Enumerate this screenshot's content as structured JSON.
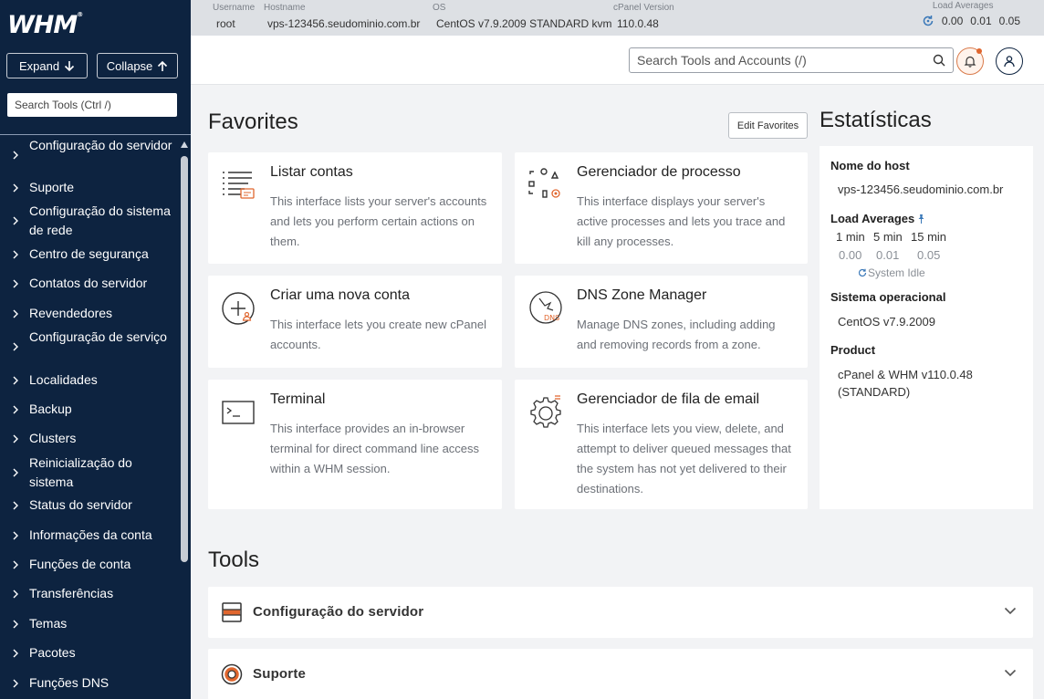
{
  "app": {
    "logo": "WHM",
    "logo_mark": "®"
  },
  "sidebar": {
    "expand_label": "Expand",
    "collapse_label": "Collapse",
    "search_placeholder": "Search Tools (Ctrl /)",
    "items": [
      {
        "label": "Configuração do servidor"
      },
      {
        "label": "Suporte"
      },
      {
        "label": "Configuração do sistema de rede"
      },
      {
        "label": "Centro de segurança"
      },
      {
        "label": "Contatos do servidor"
      },
      {
        "label": "Revendedores"
      },
      {
        "label": "Configuração de serviço"
      },
      {
        "label": "Localidades"
      },
      {
        "label": "Backup"
      },
      {
        "label": "Clusters"
      },
      {
        "label": "Reinicialização do sistema"
      },
      {
        "label": "Status do servidor"
      },
      {
        "label": "Informações da conta"
      },
      {
        "label": "Funções de conta"
      },
      {
        "label": "Transferências"
      },
      {
        "label": "Temas"
      },
      {
        "label": "Pacotes"
      },
      {
        "label": "Funções DNS"
      }
    ]
  },
  "topbar": {
    "username_label": "Username",
    "username": "root",
    "hostname_label": "Hostname",
    "hostname": "vps-123456.seudominio.com.br",
    "os_label": "OS",
    "os": "CentOS v7.9.2009 STANDARD kvm",
    "cpanel_label": "cPanel Version",
    "cpanel": "110.0.48",
    "load_label": "Load Averages",
    "load": [
      "0.00",
      "0.01",
      "0.05"
    ]
  },
  "header": {
    "search_placeholder": "Search Tools and Accounts (/)"
  },
  "favorites": {
    "title": "Favorites",
    "edit_label": "Edit Favorites",
    "cards": [
      {
        "title": "Listar contas",
        "desc": "This interface lists your server's accounts and lets you perform certain actions on them."
      },
      {
        "title": "Gerenciador de processo",
        "desc": "This interface displays your server's active processes and lets you trace and kill any processes."
      },
      {
        "title": "Criar uma nova conta",
        "desc": "This interface lets you create new cPanel accounts."
      },
      {
        "title": "DNS Zone Manager",
        "desc": "Manage DNS zones, including adding and removing records from a zone."
      },
      {
        "title": "Terminal",
        "desc": "This interface provides an in-browser terminal for direct command line access within a WHM session."
      },
      {
        "title": "Gerenciador de fila de email",
        "desc": "This interface lets you view, delete, and attempt to deliver queued messages that the system has not yet delivered to their destinations."
      }
    ],
    "dns_icon_text": "DNS"
  },
  "stats": {
    "title": "Estatísticas",
    "host_label": "Nome do host",
    "host": "vps-123456.seudominio.com.br",
    "load_label": "Load Averages",
    "load_headers": [
      "1 min",
      "5 min",
      "15 min"
    ],
    "load_values": [
      "0.00",
      "0.01",
      "0.05"
    ],
    "idle_text": "System Idle",
    "os_label": "Sistema operacional",
    "os": "CentOS v7.9.2009",
    "product_label": "Product",
    "product": "cPanel & WHM v110.0.48 (STANDARD)"
  },
  "tools": {
    "title": "Tools",
    "rows": [
      {
        "title": "Configuração do servidor"
      },
      {
        "title": "Suporte"
      }
    ]
  },
  "colors": {
    "sidebar_bg": "#0d2340",
    "accent_orange": "#e0662e",
    "topbar_bg": "#dde0e4",
    "page_bg": "#f2f3f5"
  }
}
